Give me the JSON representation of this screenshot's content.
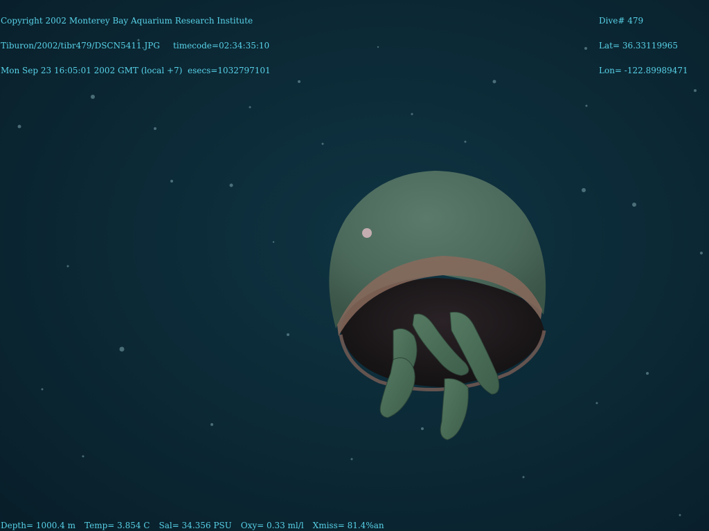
{
  "overlay_top_left": {
    "copyright": "Copyright 2002 Monterey Bay Aquarium Research Institute",
    "file_path": "Tiburon/2002/tibr479/DSCN5411.JPG",
    "timecode": "timecode=02:34:35:10",
    "datetime": "Mon Sep 23 16:05:01 2002 GMT (local +7)",
    "esecs": "esecs=1032797101"
  },
  "overlay_top_right": {
    "dive": "Dive# 479",
    "lat": "Lat= 36.33119965",
    "lon": "Lon= -122.89989471"
  },
  "overlay_bottom": {
    "depth": "Depth= 1000.4 m",
    "temp": "Temp= 3.854 C",
    "sal": "Sal= 34.356 PSU",
    "oxy": "Oxy= 0.33 ml/l",
    "xmiss": "Xmiss= 81.4%an"
  },
  "colors": {
    "overlay_text": "#58d2e8",
    "water": "#0c2a37",
    "bell": "#4f6b5f",
    "bell_rim": "#8a6a5c",
    "tentacles": "#4a6a55",
    "interior": "#1a1718"
  },
  "subject": {
    "icon": "jellyfish-icon"
  }
}
